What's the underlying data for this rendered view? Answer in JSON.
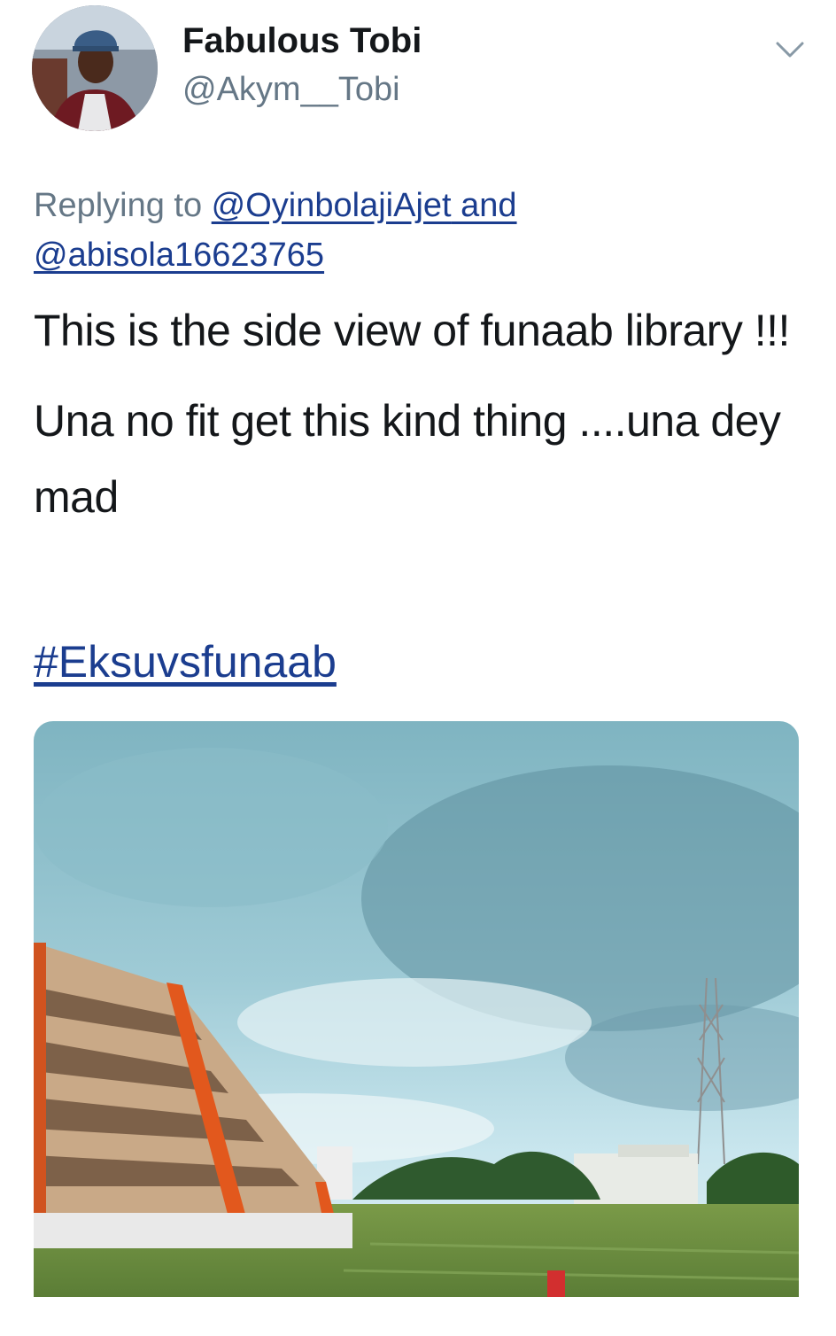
{
  "tweet": {
    "author": {
      "display_name": "Fabulous Tobi",
      "handle": "@Akym__Tobi",
      "avatar_icon": "profile-photo"
    },
    "reply": {
      "prefix": "Replying to ",
      "user1": "@OyinbolajiAjet",
      "joiner": " and",
      "user2": "@abisola16623765"
    },
    "text": {
      "line1": "This is the side view of funaab library !!!",
      "line2": "Una no fit get this kind thing ....una dey mad"
    },
    "hashtag": "#Eksuvsfunaab",
    "menu_icon": "chevron-down-icon",
    "link_color": "#1b3d8f"
  }
}
